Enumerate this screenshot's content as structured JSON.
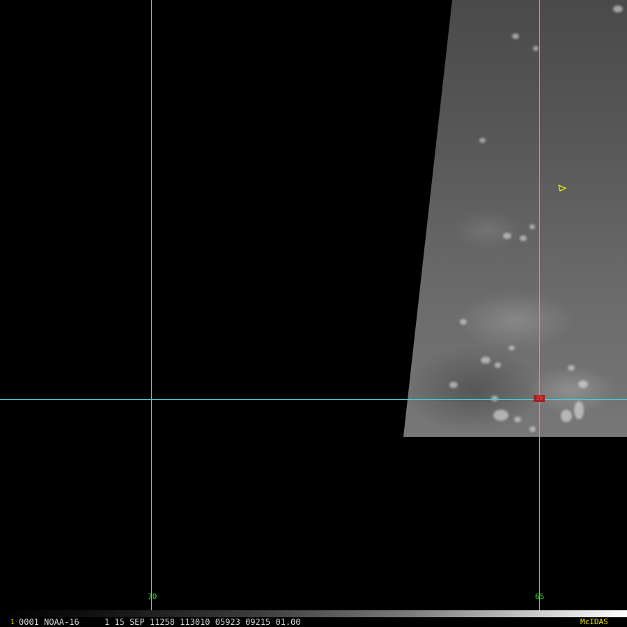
{
  "satellite_image": {
    "grid": {
      "line_color": "#3fd0d6",
      "longitude_labels": [
        {
          "value": "70"
        },
        {
          "value": "65"
        }
      ],
      "latitude_marker": {
        "value": "30",
        "color": "#ff4040"
      }
    },
    "storm_marker": {
      "icon": "triangle-marker-icon",
      "color": "#ffff00"
    },
    "info_bar": {
      "frame_number": "1",
      "text": "0001 NOAA-16     1 15 SEP 11258 113010 05923 09215 01.00",
      "brand": "McIDAS",
      "text_color": "#d8d8d8",
      "brand_color": "#e8e000"
    }
  }
}
